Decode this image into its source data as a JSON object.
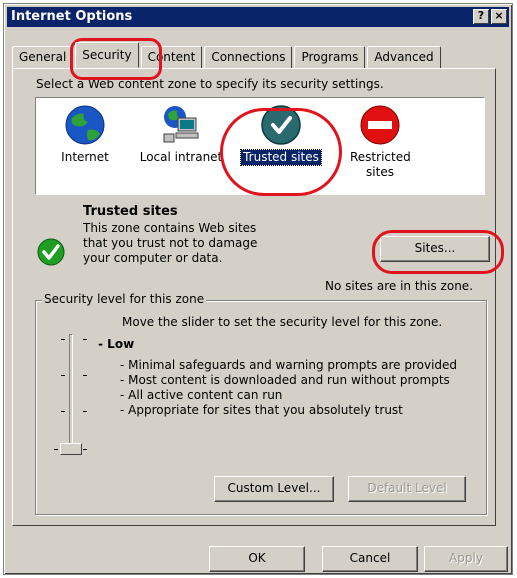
{
  "window": {
    "title": "Internet Options",
    "help_label": "?",
    "close_label": "×"
  },
  "tabs": [
    {
      "label": "General"
    },
    {
      "label": "Security",
      "active": true
    },
    {
      "label": "Content"
    },
    {
      "label": "Connections"
    },
    {
      "label": "Programs"
    },
    {
      "label": "Advanced"
    }
  ],
  "security": {
    "instruction": "Select a Web content zone to specify its security settings.",
    "zones": [
      {
        "label": "Internet",
        "icon": "globe-icon"
      },
      {
        "label": "Local intranet",
        "icon": "network-computer-icon"
      },
      {
        "label": "Trusted sites",
        "icon": "trusted-check-icon",
        "selected": true
      },
      {
        "label": "Restricted sites",
        "icon": "restricted-icon"
      }
    ],
    "zone_title": "Trusted sites",
    "zone_description": "This zone contains Web sites that you trust not to damage your computer or data.",
    "sites_button": "Sites...",
    "no_sites_text": "No sites are in this zone.",
    "level_group_label": "Security level for this zone",
    "slider_hint": "Move the slider to set the security level for this zone.",
    "level_name": "Low",
    "level_bullets": [
      "- Minimal safeguards and warning prompts are provided",
      "- Most content is downloaded and run without prompts",
      "- All active content can run",
      "- Appropriate for sites that you absolutely trust"
    ],
    "slider_level": "Low",
    "custom_level_button": "Custom Level...",
    "default_level_button": "Default Level"
  },
  "footer": {
    "ok": "OK",
    "cancel": "Cancel",
    "apply": "Apply"
  },
  "colors": {
    "titlebar": "#0a246a",
    "face": "#d4d0c8",
    "highlight_annotation": "#e0141e",
    "check_green": "#1e9e22"
  }
}
